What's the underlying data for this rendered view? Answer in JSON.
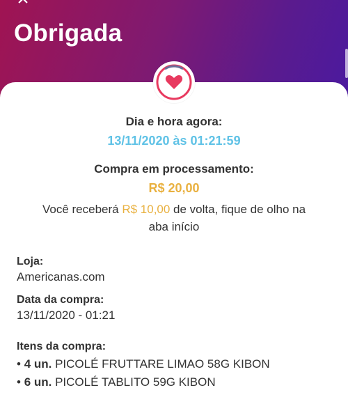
{
  "header": {
    "close_icon": "×",
    "title": "Obrigada"
  },
  "badge": {
    "icon": "heart-icon",
    "ring_color": "#e8395f",
    "heart_color": "#e8395f"
  },
  "status": {
    "datetime_label": "Dia e hora agora:",
    "datetime_value": "13/11/2020 às 01:21:59",
    "processing_label": "Compra em processamento:",
    "amount": "R$ 20,00",
    "cashback_prefix": "Você receberá ",
    "cashback_amount": "R$ 10,00",
    "cashback_suffix": " de volta, fique de olho na",
    "cashback_line2": "aba início"
  },
  "details": {
    "store_label": "Loja:",
    "store_value": "Americanas.com",
    "date_label": "Data da compra:",
    "date_value": "13/11/2020 - 01:21",
    "items_label": "Itens da compra:",
    "items": [
      {
        "qty": "4 un.",
        "name": "PICOLÉ FRUTTARE LIMAO 58G KIBON"
      },
      {
        "qty": "6 un.",
        "name": "PICOLÉ TABLITO 59G KIBON"
      }
    ]
  },
  "colors": {
    "header_gradient_start": "#a01452",
    "header_gradient_end": "#4a1aa0",
    "datetime": "#5fc2e6",
    "amount": "#e9b140",
    "text": "#333333"
  }
}
